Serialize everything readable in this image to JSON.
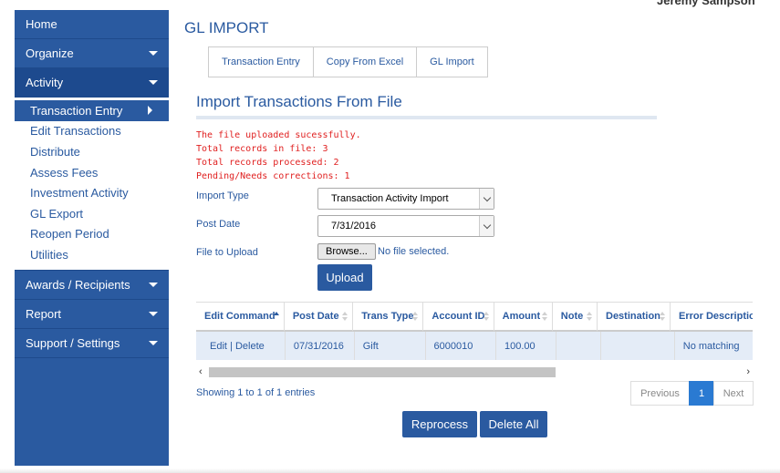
{
  "header": {
    "user_name_clipped": "Jeremy Sampson"
  },
  "sidebar": {
    "items": [
      {
        "label": "Home"
      },
      {
        "label": "Organize"
      },
      {
        "label": "Activity"
      },
      {
        "label": "Awards / Recipients"
      },
      {
        "label": "Report"
      },
      {
        "label": "Support / Settings"
      }
    ],
    "activity_sub": [
      {
        "label": "Transaction Entry"
      },
      {
        "label": "Edit Transactions"
      },
      {
        "label": "Distribute"
      },
      {
        "label": "Assess Fees"
      },
      {
        "label": "Investment Activity"
      },
      {
        "label": "GL Export"
      },
      {
        "label": "Reopen Period"
      },
      {
        "label": "Utilities"
      }
    ]
  },
  "page": {
    "title": "GL IMPORT",
    "tabs": [
      {
        "label": "Transaction Entry"
      },
      {
        "label": "Copy From Excel"
      },
      {
        "label": "GL Import"
      }
    ],
    "section_title": "Import Transactions From File"
  },
  "messages": [
    "The file uploaded sucessfully.",
    "Total records in file: 3",
    "Total records processed: 2",
    "Pending/Needs corrections: 1"
  ],
  "form": {
    "import_type_label": "Import Type",
    "import_type_value": "Transaction Activity Import",
    "post_date_label": "Post Date",
    "post_date_value": "7/31/2016",
    "file_label": "File to Upload",
    "browse_label": "Browse...",
    "no_file_text": "No file selected.",
    "upload_label": "Upload"
  },
  "table": {
    "columns": [
      "Edit Command",
      "Post Date",
      "Trans Type",
      "Account ID",
      "Amount",
      "Note",
      "Destination",
      "Error Description"
    ],
    "rows": [
      {
        "edit": "Edit",
        "sep": "|",
        "delete": "Delete",
        "post_date": "07/31/2016",
        "trans_type": "Gift",
        "account_id": "6000010",
        "amount": "100.00",
        "note": "",
        "destination": "",
        "error": "No matching"
      }
    ]
  },
  "footer": {
    "showing": "Showing 1 to 1 of 1 entries",
    "pager": {
      "previous": "Previous",
      "page": "1",
      "next": "Next"
    },
    "reprocess_label": "Reprocess",
    "delete_all_label": "Delete All"
  },
  "colors": {
    "accent": "#2a5aa0",
    "error": "#e02020",
    "row_bg": "#e4ecf7",
    "pager_active": "#2a7ad2"
  }
}
